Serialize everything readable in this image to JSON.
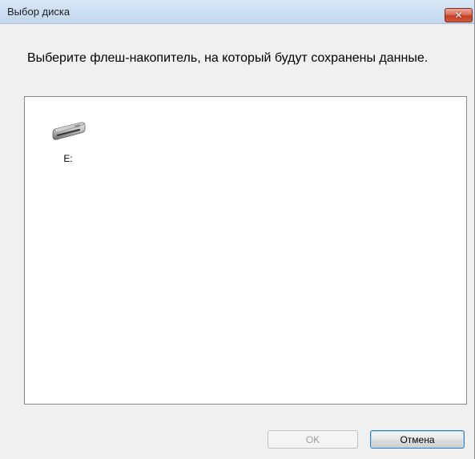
{
  "window": {
    "title": "Выбор диска",
    "close_icon": "close-icon"
  },
  "instruction": "Выберите флеш-накопитель, на который будут сохранены данные.",
  "drives": [
    {
      "label": "E:",
      "icon": "usb-flash-drive-icon"
    }
  ],
  "buttons": {
    "ok": {
      "label": "OK",
      "enabled": false
    },
    "cancel": {
      "label": "Отмена",
      "enabled": true
    }
  },
  "colors": {
    "close_button": "#c13f26",
    "titlebar": "#cddff2",
    "default_button_border": "#3c7fb1"
  }
}
